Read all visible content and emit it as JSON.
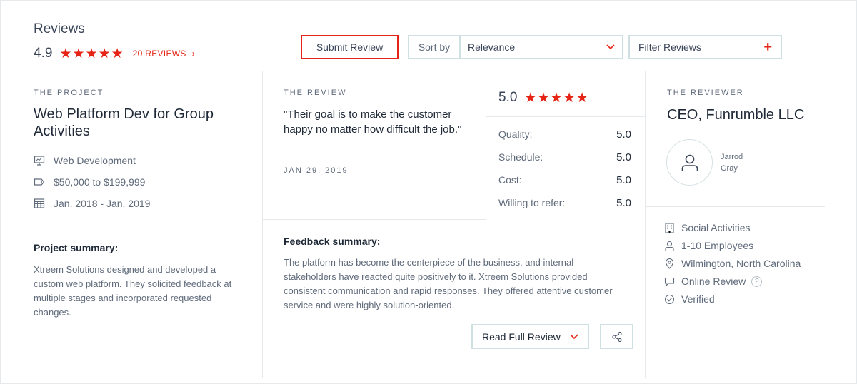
{
  "header": {
    "title": "Reviews",
    "overall_score": "4.9",
    "stars": 5,
    "reviews_link": "20 REVIEWS",
    "submit_button": "Submit Review",
    "sort_label": "Sort by",
    "sort_value": "Relevance",
    "filter_label": "Filter Reviews"
  },
  "project": {
    "eyebrow": "THE PROJECT",
    "title": "Web Platform Dev for Group Activities",
    "service": "Web Development",
    "budget": "$50,000 to $199,999",
    "dates": "Jan. 2018 - Jan. 2019",
    "summary_heading": "Project summary:",
    "summary": "Xtreem Solutions designed and developed a custom web platform. They solicited feedback at multiple stages and incorporated requested changes."
  },
  "review": {
    "eyebrow": "THE REVIEW",
    "quote": "\"Their goal is to make the customer happy no matter how difficult the job.\"",
    "date": "JAN 29, 2019",
    "rating": "5.0",
    "stars": 5,
    "scores": [
      {
        "label": "Quality:",
        "value": "5.0"
      },
      {
        "label": "Schedule:",
        "value": "5.0"
      },
      {
        "label": "Cost:",
        "value": "5.0"
      },
      {
        "label": "Willing to refer:",
        "value": "5.0"
      }
    ],
    "feedback_heading": "Feedback summary:",
    "feedback": "The platform has become the centerpiece of the business, and internal stakeholders have reacted quite positively to it. Xtreem Solutions provided consistent communication and rapid responses. They offered attentive customer service and were highly solution-oriented.",
    "read_button": "Read Full Review"
  },
  "reviewer": {
    "eyebrow": "THE REVIEWER",
    "title": "CEO, Funrumble LLC",
    "name_first": "Jarrod",
    "name_last": "Gray",
    "industry": "Social Activities",
    "size": "1-10 Employees",
    "location": "Wilmington, North Carolina",
    "review_type": "Online Review",
    "help_glyph": "?",
    "status": "Verified"
  },
  "colors": {
    "accent": "#e62415",
    "text": "#3b4559",
    "border": "#cfe0e3"
  }
}
